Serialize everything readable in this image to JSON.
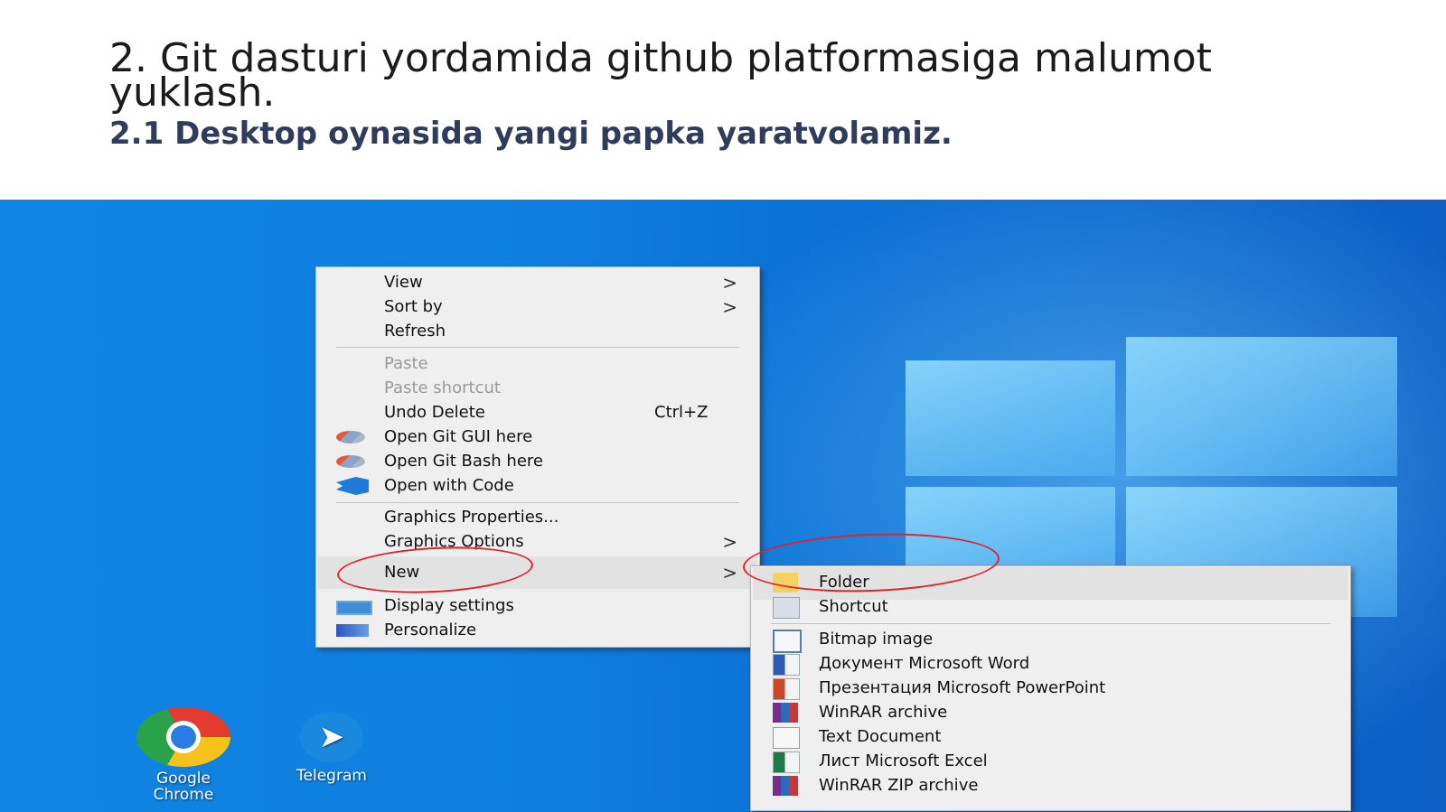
{
  "slide": {
    "title": "2. Git dasturi yordamida github platformasiga malumot yuklash.",
    "subtitle": "2.1 Desktop oynasida yangi papka yaratvolamiz."
  },
  "context_menu": {
    "items": [
      {
        "label": "View",
        "has_submenu": true
      },
      {
        "label": "Sort by",
        "has_submenu": true
      },
      {
        "label": "Refresh"
      },
      {
        "label": "Paste",
        "disabled": true
      },
      {
        "label": "Paste shortcut",
        "disabled": true
      },
      {
        "label": "Undo Delete",
        "shortcut": "Ctrl+Z"
      },
      {
        "label": "Open Git GUI here",
        "icon": "git-icon"
      },
      {
        "label": "Open Git Bash here",
        "icon": "git-icon"
      },
      {
        "label": "Open with Code",
        "icon": "vscode-icon"
      },
      {
        "label": "Graphics Properties..."
      },
      {
        "label": "Graphics Options",
        "has_submenu": true
      },
      {
        "label": "New",
        "has_submenu": true,
        "highlighted": true
      },
      {
        "label": "Display settings",
        "icon": "display-icon"
      },
      {
        "label": "Personalize",
        "icon": "personalize-icon"
      }
    ],
    "arrow_glyph": ">"
  },
  "new_submenu": {
    "items": [
      {
        "label": "Folder",
        "icon": "folder-icon",
        "highlighted": true
      },
      {
        "label": "Shortcut",
        "icon": "shortcut-icon"
      },
      {
        "label": "Bitmap image",
        "icon": "bitmap-icon"
      },
      {
        "label": "Документ Microsoft Word",
        "icon": "word-icon"
      },
      {
        "label": "Презентация Microsoft PowerPoint",
        "icon": "powerpoint-icon"
      },
      {
        "label": "WinRAR archive",
        "icon": "winrar-icon"
      },
      {
        "label": "Text Document",
        "icon": "text-document-icon"
      },
      {
        "label": "Лист Microsoft Excel",
        "icon": "excel-icon"
      },
      {
        "label": "WinRAR ZIP archive",
        "icon": "winrar-icon"
      }
    ]
  },
  "desktop_icons": [
    {
      "label": "Google Chrome",
      "icon": "chrome-icon"
    },
    {
      "label": "Telegram",
      "icon": "telegram-icon"
    }
  ],
  "annotations": {
    "color": "#e0222a"
  },
  "colors": {
    "desktop_blue": "#0f7fe0",
    "menu_bg": "#efefef",
    "subtitle": "#2e3d5c"
  }
}
